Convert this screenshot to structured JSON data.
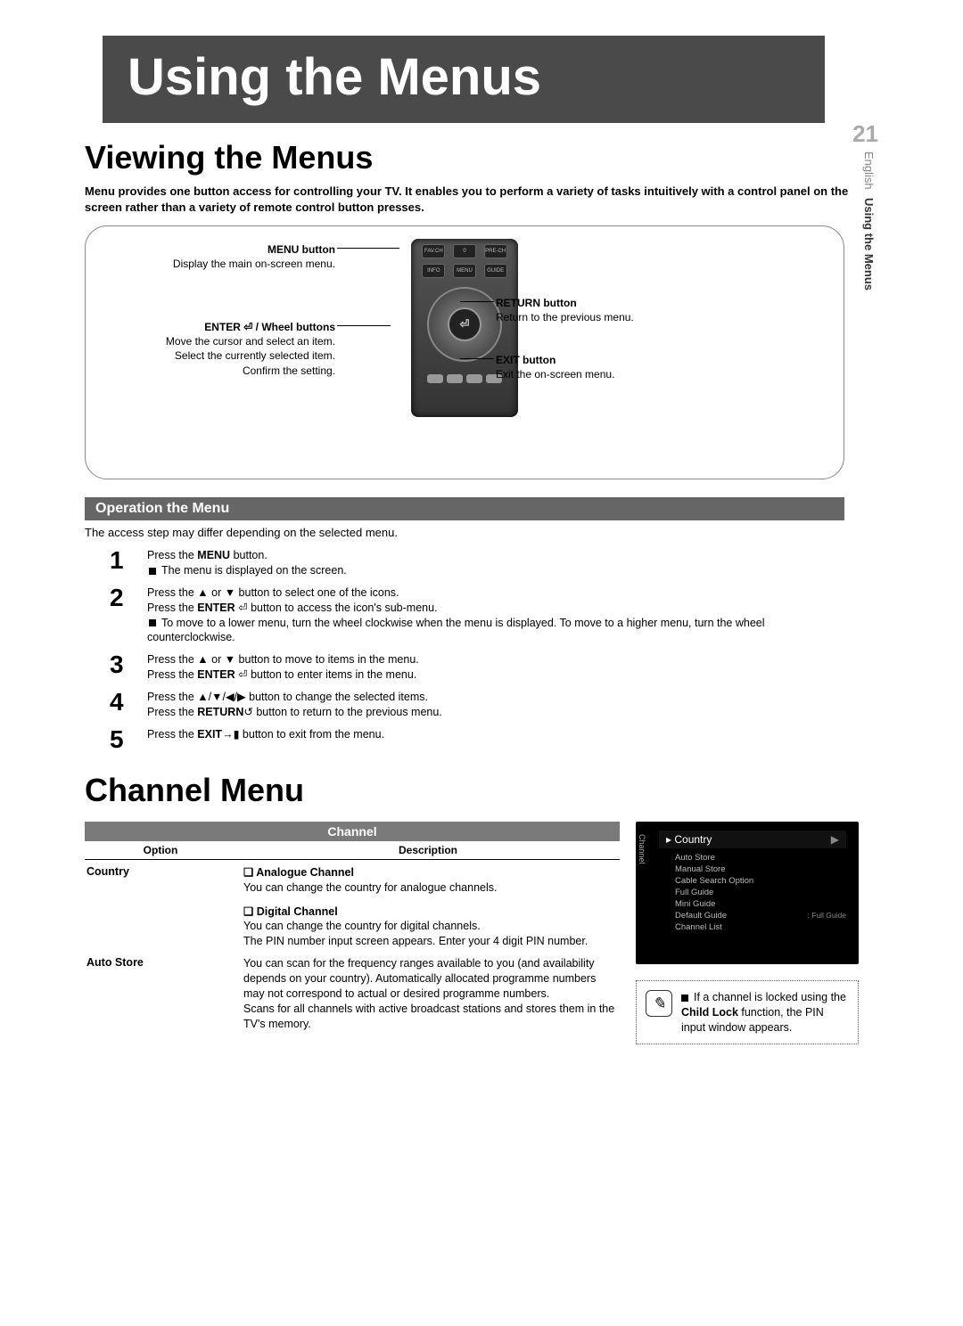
{
  "page_number": "21",
  "side_tab": {
    "lang": "English",
    "section": "Using the Menus"
  },
  "chapter_title": "Using the Menus",
  "section1": {
    "title": "Viewing the Menus",
    "intro": "Menu provides one button access for controlling your TV. It enables you to perform a variety of tasks intuitively with a control panel on the screen rather than a variety of remote control button presses.",
    "callouts": {
      "menu": {
        "label": "MENU button",
        "desc": "Display the main on-screen menu."
      },
      "enter": {
        "label": "ENTER ⏎ / Wheel buttons",
        "desc1": "Move the cursor and select an item.",
        "desc2": "Select the currently selected item.",
        "desc3": "Confirm the setting."
      },
      "return": {
        "label": "RETURN button",
        "desc": "Return to the previous menu."
      },
      "exit": {
        "label": "EXIT button",
        "desc": "Exit the on-screen menu."
      }
    },
    "remote_buttons": {
      "r1a": "FAV.CH",
      "r1b": "0",
      "r1c": "PRE-CH",
      "r2a": "INFO",
      "r2b": "MENU",
      "r2c": "GUIDE"
    },
    "op_banner": "Operation the Menu",
    "op_note": "The access step may differ depending on the selected menu.",
    "steps": [
      {
        "n": "1",
        "l1": "Press the <b>MENU</b> button.",
        "bullet": "The menu is displayed on the screen."
      },
      {
        "n": "2",
        "l1": "Press the ▲ or ▼ button to select one of the icons.",
        "l2": "Press the <b>ENTER</b> ⏎ button to access the icon's sub-menu.",
        "bullet": "To move to a lower menu, turn the wheel clockwise when the menu is displayed. To move to a higher menu, turn the wheel counterclockwise."
      },
      {
        "n": "3",
        "l1": "Press the ▲ or ▼ button to move to items in the menu.",
        "l2": "Press the <b>ENTER</b> ⏎ button to enter items in the menu."
      },
      {
        "n": "4",
        "l1": "Press the ▲/▼/◀/▶ button to change the selected items.",
        "l2": "Press the <b>RETURN</b>↺ button to return to the previous menu."
      },
      {
        "n": "5",
        "l1": "Press the <b>EXIT</b>→▮ button to exit from the menu."
      }
    ]
  },
  "section2": {
    "title": "Channel Menu",
    "table_title": "Channel",
    "col1": "Option",
    "col2": "Description",
    "rows": [
      {
        "option": "Country",
        "blocks": [
          {
            "label": "Analogue Channel",
            "desc": "You can change the country for analogue channels."
          },
          {
            "label": "Digital Channel",
            "desc": "You can change the country for digital channels.\nThe PIN number input screen appears. Enter your 4 digit PIN number."
          }
        ]
      },
      {
        "option": "Auto Store",
        "text": "You can scan for the frequency ranges available to you (and availability depends on your country). Automatically allocated programme numbers may not correspond to actual or desired programme numbers.\nScans for all channels with active broadcast stations and stores them in the TV's memory."
      }
    ],
    "osd": {
      "side": "Channel",
      "main": "Country",
      "items": [
        {
          "t": "Auto Store"
        },
        {
          "t": "Manual Store"
        },
        {
          "t": "Cable Search Option"
        },
        {
          "t": "Full Guide"
        },
        {
          "t": "Mini Guide"
        },
        {
          "t": "Default Guide",
          "v": ": Full Guide"
        },
        {
          "t": "Channel List"
        }
      ]
    },
    "note": "If a channel is locked using the <b>Child Lock</b> function, the PIN input window appears."
  }
}
